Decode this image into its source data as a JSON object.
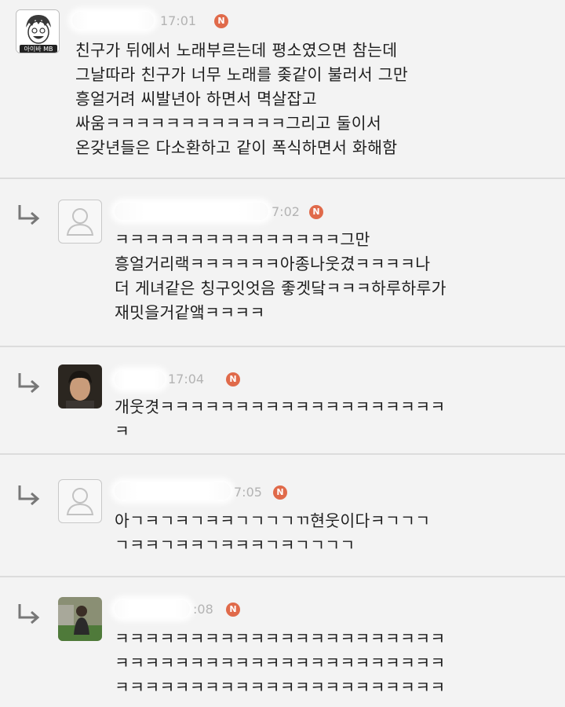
{
  "comments": [
    {
      "time": "17:01",
      "badge": "N",
      "lines": [
        "친구가 뒤에서 노래부르는데 평소였으면 참는데",
        "그날따라 친구가 너무 노래를 좆같이 불러서 그만",
        "흥얼거려 씨발년아 하면서 멱살잡고",
        "싸움ㅋㅋㅋㅋㅋㅋㅋㅋㅋㅋㅋㅋ그리고 둘이서",
        "온갖년들은 다소환하고 같이 폭식하면서 화해함"
      ]
    },
    {
      "time": "7:02",
      "badge": "N",
      "lines": [
        "ㅋㅋㅋㅋㅋㅋㅋㅋㅋㅋㅋㅋㅋㅋㅋ그만",
        "흥얼거리랙ㅋㅋㅋㅋㅋㅋ아종나웃겼ㅋㅋㅋㅋ나",
        "더 게녀같은 칭구잇엇음 좋겟닼ㅋㅋㅋ하루하루가",
        "재밋을거같앸ㅋㅋㅋㅋ"
      ]
    },
    {
      "time": "17:04",
      "badge": "N",
      "lines": [
        "개웃겻ㅋㅋㅋㅋㅋㅋㅋㅋㅋㅋㅋㅋㅋㅋㅋㅋㅋㅋㅋ",
        "ㅋ"
      ]
    },
    {
      "time": "7:05",
      "badge": "N",
      "lines": [
        "아ㄱㅋㄱㅋㄱㅋㅋㄱㄱㄱㄱㄲ현웃이다ㅋㄱㄱㄱ",
        "ㄱㅋㅋㄱㅋㅋㄱㅋㅋㅋㄱㅋㄱㄱㄱㄱ"
      ]
    },
    {
      "time": ":08",
      "badge": "N",
      "lines": [
        "ㅋㅋㅋㅋㅋㅋㅋㅋㅋㅋㅋㅋㅋㅋㅋㅋㅋㅋㅋㅋㅋㅋ",
        "ㅋㅋㅋㅋㅋㅋㅋㅋㅋㅋㅋㅋㅋㅋㅋㅋㅋㅋㅋㅋㅋㅋ",
        "ㅋㅋㅋㅋㅋㅋㅋㅋㅋㅋㅋㅋㅋㅋㅋㅋㅋㅋㅋㅋㅋㅋ"
      ]
    }
  ],
  "avatar_badge_text": "아이바 MB",
  "colors": {
    "background": "#f3f3f3",
    "badge": "#e06a4a",
    "timestamp": "#b3b3b3",
    "separator": "#dcdcdc"
  },
  "icons": [
    "reply-arrow-icon",
    "new-badge-icon",
    "default-profile-icon"
  ]
}
